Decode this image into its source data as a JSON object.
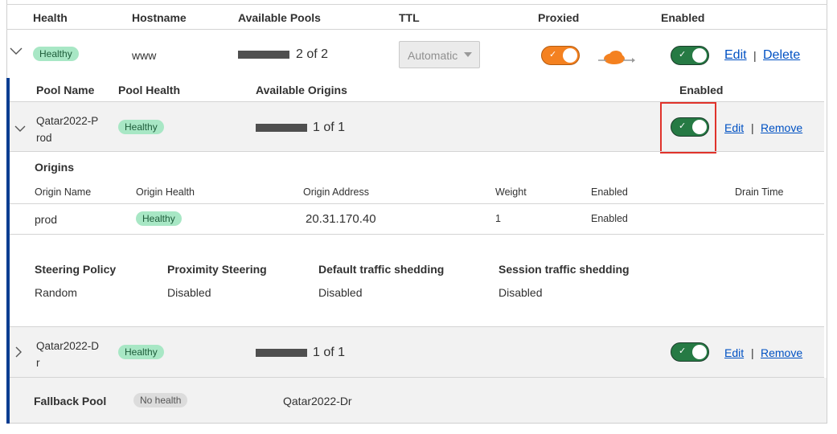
{
  "table": {
    "headers": {
      "health": "Health",
      "hostname": "Hostname",
      "available_pools": "Available Pools",
      "ttl": "TTL",
      "proxied": "Proxied",
      "enabled": "Enabled"
    },
    "record": {
      "health": "Healthy",
      "hostname": "www",
      "available_pools": "2 of 2",
      "available_pools_fraction": 1.0,
      "ttl": "Automatic",
      "proxied": true,
      "enabled": true,
      "edit": "Edit",
      "separator": "|",
      "delete": "Delete"
    }
  },
  "pools": {
    "headers": {
      "pool_name": "Pool Name",
      "pool_health": "Pool Health",
      "available_origins": "Available Origins",
      "enabled": "Enabled"
    },
    "items": [
      {
        "name_line1": "Qatar2022-P",
        "name_line2": "rod",
        "health": "Healthy",
        "available_origins": "1 of 1",
        "available_origins_fraction": 1.0,
        "enabled": true,
        "expanded": true,
        "edit": "Edit",
        "separator": "|",
        "remove": "Remove"
      },
      {
        "name_line1": "Qatar2022-D",
        "name_line2": "r",
        "health": "Healthy",
        "available_origins": "1 of 1",
        "available_origins_fraction": 1.0,
        "enabled": true,
        "expanded": false,
        "edit": "Edit",
        "separator": "|",
        "remove": "Remove"
      }
    ]
  },
  "origins": {
    "title": "Origins",
    "headers": {
      "origin_name": "Origin Name",
      "origin_health": "Origin Health",
      "origin_address": "Origin Address",
      "weight": "Weight",
      "enabled": "Enabled",
      "drain_time": "Drain Time"
    },
    "rows": [
      {
        "name": "prod",
        "health": "Healthy",
        "address": "20.31.170.40",
        "weight": "1",
        "enabled": "Enabled",
        "drain_time": ""
      }
    ]
  },
  "policy": {
    "steering_policy_label": "Steering Policy",
    "steering_policy_value": "Random",
    "proximity_label": "Proximity Steering",
    "proximity_value": "Disabled",
    "default_shedding_label": "Default traffic shedding",
    "default_shedding_value": "Disabled",
    "session_shedding_label": "Session traffic shedding",
    "session_shedding_value": "Disabled"
  },
  "fallback": {
    "label": "Fallback Pool",
    "health": "No health",
    "pool": "Qatar2022-Dr"
  },
  "colors": {
    "healthy_badge": "#a8e7c5",
    "toggle_enabled": "#267a44",
    "proxied_orange": "#f48120",
    "link_blue": "#0051c3",
    "highlight_red": "#e0332b",
    "accent_bar": "#0a3d91"
  },
  "icons": {
    "expand_open": "chevron-down-icon",
    "expand_closed": "chevron-right-icon",
    "proxied_cloud": "cloud-icon",
    "select_caret": "caret-down-icon",
    "toggle_check": "check-icon"
  }
}
